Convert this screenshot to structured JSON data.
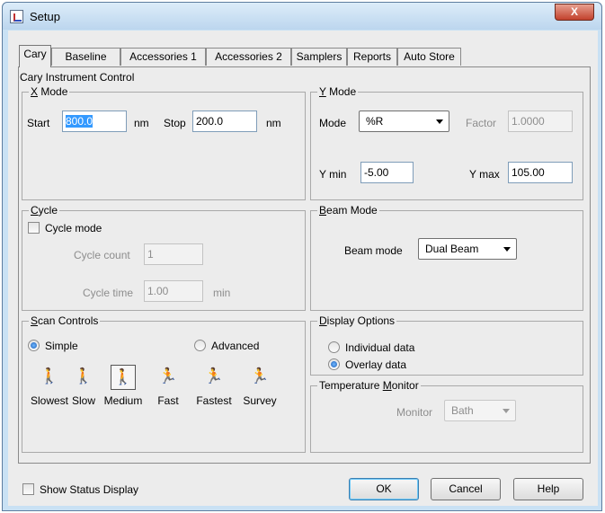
{
  "window": {
    "title": "Setup",
    "close_glyph": "X"
  },
  "tabs": [
    "Cary",
    "Baseline",
    "Accessories 1",
    "Accessories 2",
    "Samplers",
    "Reports",
    "Auto Store"
  ],
  "section_title": "Cary Instrument Control",
  "x_mode": {
    "legend_first": "X",
    "legend_rest": " Mode",
    "start_label": "Start",
    "start_value": "800.0",
    "start_unit": "nm",
    "stop_label": "Stop",
    "stop_value": "200.0",
    "stop_unit": "nm"
  },
  "y_mode": {
    "legend_first": "Y",
    "legend_rest": " Mode",
    "mode_label": "Mode",
    "mode_value": "%R",
    "factor_label": "Factor",
    "factor_value": "1.0000",
    "ymin_label": "Y min",
    "ymin_value": "-5.00",
    "ymax_label": "Y max",
    "ymax_value": "105.00"
  },
  "cycle": {
    "legend_first": "C",
    "legend_rest": "ycle",
    "checkbox_label": "Cycle mode",
    "count_label": "Cycle count",
    "count_value": "1",
    "time_label": "Cycle time",
    "time_value": "1.00",
    "time_unit": "min"
  },
  "beam_mode": {
    "legend_first": "B",
    "legend_rest": "eam Mode",
    "label": "Beam mode",
    "value": "Dual Beam"
  },
  "scan_controls": {
    "legend_first": "S",
    "legend_rest": "can Controls",
    "simple_label": "Simple",
    "advanced_label": "Advanced",
    "speeds": [
      "Slowest",
      "Slow",
      "Medium",
      "Fast",
      "Fastest",
      "Survey"
    ],
    "selected_speed": "Medium"
  },
  "display_options": {
    "legend_first": "D",
    "legend_rest": "isplay Options",
    "individual_label": "Individual data",
    "overlay_label": "Overlay data"
  },
  "temperature": {
    "legend_pre": "Temperature ",
    "legend_first": "M",
    "legend_rest": "onitor",
    "label": "Monitor",
    "value": "Bath"
  },
  "footer": {
    "status_label": "Show Status Display",
    "ok_label": "OK",
    "cancel_label": "Cancel",
    "help_label": "Help"
  }
}
